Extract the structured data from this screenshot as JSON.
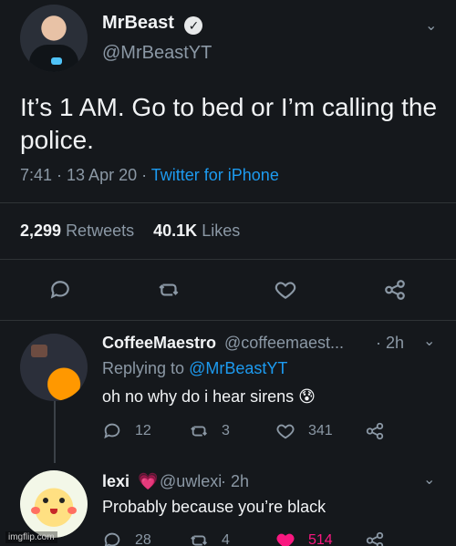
{
  "main_tweet": {
    "display_name": "MrBeast",
    "handle": "@MrBeastYT",
    "text": "It’s 1 AM. Go to bed or I’m calling the police.",
    "time": "7:41 · 13 Apr 20 · ",
    "client": "Twitter for iPhone",
    "retweets_count": "2,299",
    "retweets_label": "Retweets",
    "likes_count": "40.1K",
    "likes_label": "Likes",
    "icons": {
      "reply": "comment-icon",
      "retweet": "retweet-icon",
      "like": "heart-icon",
      "share": "share-icon"
    }
  },
  "replies": [
    {
      "display_name": "CoffeeMaestro",
      "handle": "@coffeemaest...",
      "time": "· 2h",
      "replying_prefix": "Replying to ",
      "replying_to": "@MrBeastYT",
      "text": "oh no why do i hear sirens 😰",
      "reply_count": "12",
      "retweet_count": "3",
      "like_count": "341"
    },
    {
      "display_name": "lexi",
      "handle": "@uwlexi",
      "time": "· 2h",
      "text": "Probably because you’re black",
      "reply_count": "28",
      "retweet_count": "4",
      "like_count": "514"
    }
  ],
  "watermark": "imgflip.com",
  "colors": {
    "background": "#15181c",
    "muted": "#8b98a5",
    "link": "#1d9bf0",
    "liked": "#f91880"
  }
}
